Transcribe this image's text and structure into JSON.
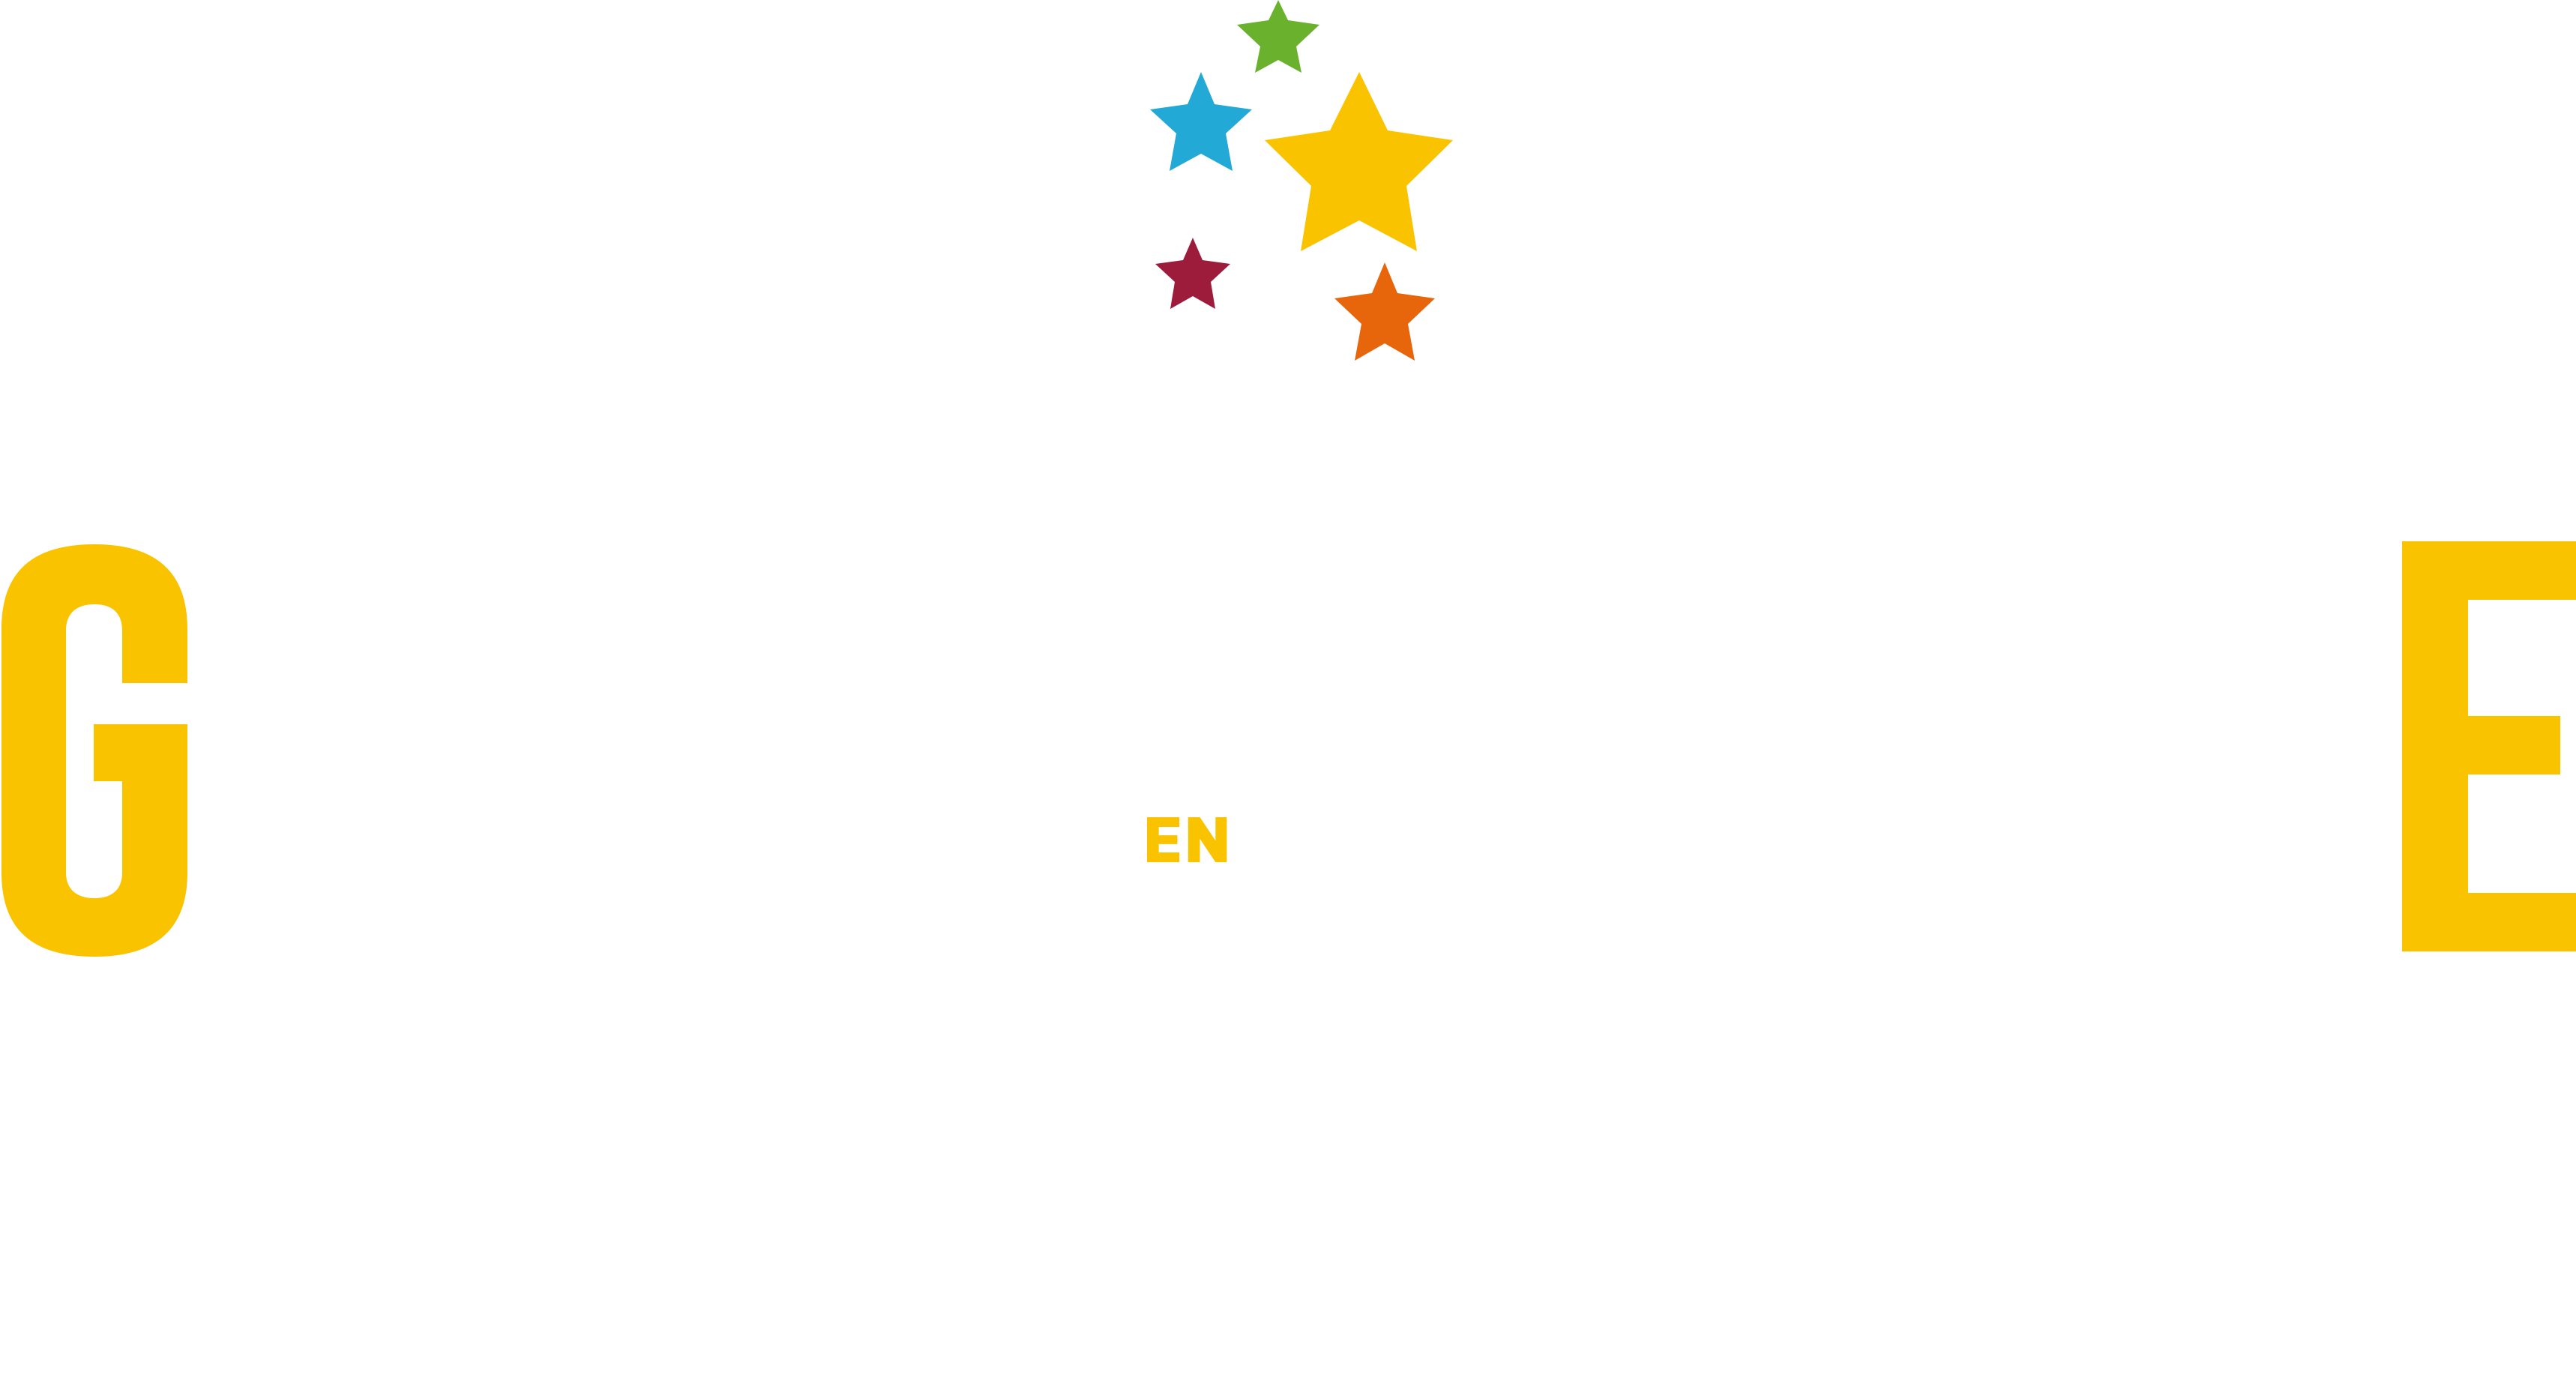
{
  "logo": {
    "letters": {
      "first": "G",
      "middle": "EN",
      "last": "E"
    },
    "colors": {
      "letters": "#f9c300",
      "star_large": "#f9c300",
      "star_green": "#6ab22e",
      "star_blue": "#23a9d6",
      "star_red": "#9d1b3b",
      "star_orange": "#e8660b"
    },
    "icons": [
      "star-large-icon",
      "star-green-icon",
      "star-blue-icon",
      "star-red-icon",
      "star-orange-icon"
    ]
  }
}
